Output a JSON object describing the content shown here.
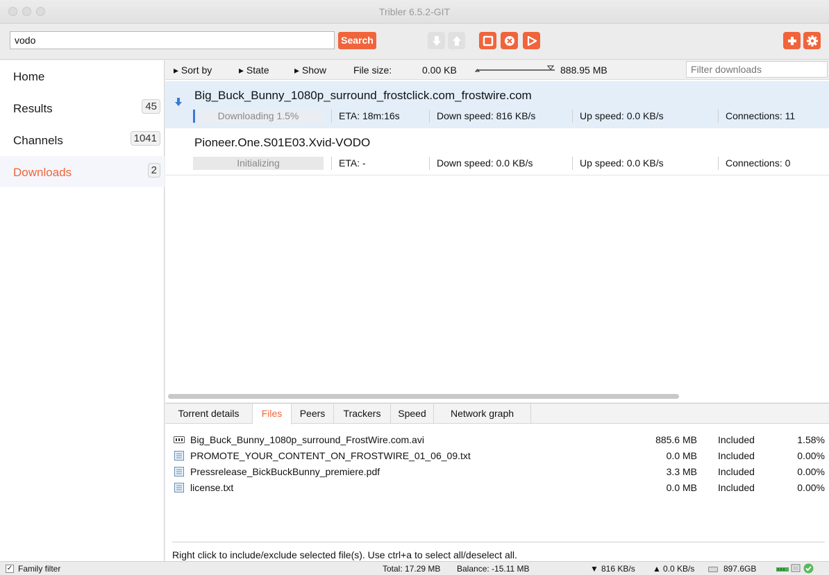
{
  "window": {
    "title": "Tribler 6.5.2-GIT"
  },
  "toolbar": {
    "search_value": "vodo",
    "search_label": "Search"
  },
  "sidebar": {
    "items": [
      {
        "label": "Home",
        "count": ""
      },
      {
        "label": "Results",
        "count": "45"
      },
      {
        "label": "Channels",
        "count": "1041"
      },
      {
        "label": "Downloads",
        "count": "2"
      }
    ]
  },
  "filterbar": {
    "sort_by": "Sort by",
    "state": "State",
    "show": "Show",
    "file_size_label": "File size:",
    "min_size": "0.00 KB",
    "max_size": "888.95 MB",
    "filter_placeholder": "Filter downloads"
  },
  "downloads": [
    {
      "name": "Big_Buck_Bunny_1080p_surround_frostclick.com_frostwire.com",
      "status": "Downloading 1.5%",
      "progress": 0.015,
      "eta": "ETA: 18m:16s",
      "down": "Down speed: 816 KB/s",
      "up": "Up speed: 0.0 KB/s",
      "connections": "Connections: 11"
    },
    {
      "name": "Pioneer.One.S01E03.Xvid-VODO",
      "status": "Initializing",
      "progress": 0,
      "eta": "ETA: -",
      "down": "Down speed: 0.0 KB/s",
      "up": "Up speed: 0.0 KB/s",
      "connections": "Connections: 0"
    }
  ],
  "details": {
    "tabs": [
      "Torrent details",
      "Files",
      "Peers",
      "Trackers",
      "Speed",
      "Network graph"
    ],
    "active_tab": "Files",
    "files": [
      {
        "name": "Big_Buck_Bunny_1080p_surround_FrostWire.com.avi",
        "size": "885.6 MB",
        "status": "Included",
        "pct": "1.58%",
        "icon": "video-file-icon"
      },
      {
        "name": "PROMOTE_YOUR_CONTENT_ON_FROSTWIRE_01_06_09.txt",
        "size": "0.0 MB",
        "status": "Included",
        "pct": "0.00%",
        "icon": "text-file-icon"
      },
      {
        "name": "Pressrelease_BickBuckBunny_premiere.pdf",
        "size": "3.3 MB",
        "status": "Included",
        "pct": "0.00%",
        "icon": "text-file-icon"
      },
      {
        "name": "license.txt",
        "size": "0.0 MB",
        "status": "Included",
        "pct": "0.00%",
        "icon": "text-file-icon"
      }
    ],
    "hint": "Right click to include/exclude selected file(s). Use ctrl+a to select all/deselect all."
  },
  "statusbar": {
    "family_filter": "Family filter",
    "total": "Total: 17.29 MB",
    "balance": "Balance: -15.11 MB",
    "down": "816 KB/s",
    "up": "0.0 KB/s",
    "disk": "897.6GB"
  },
  "colors": {
    "accent": "#f0643c",
    "selection": "#e3eef9",
    "download_arrow": "#3a7bd5"
  }
}
